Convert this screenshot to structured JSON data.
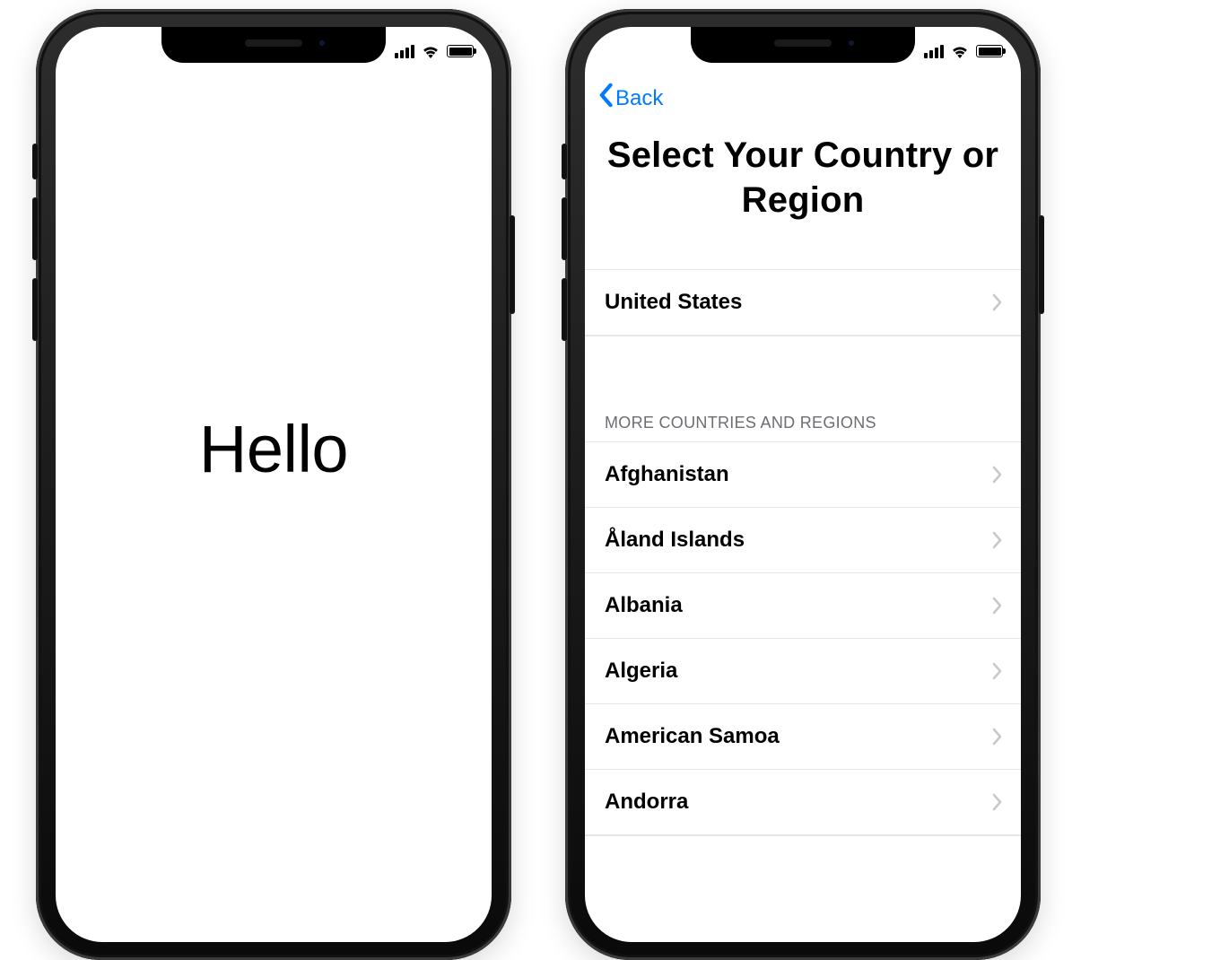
{
  "left_screen": {
    "greeting": "Hello"
  },
  "right_screen": {
    "back_label": "Back",
    "title": "Select Your Country or Region",
    "primary_country": "United States",
    "more_section_header": "MORE COUNTRIES AND REGIONS",
    "countries": [
      "Afghanistan",
      "Åland Islands",
      "Albania",
      "Algeria",
      "American Samoa",
      "Andorra"
    ]
  },
  "status": {
    "cellular_bars": 4,
    "wifi": true,
    "battery_full": true
  },
  "colors": {
    "ios_blue": "#007aff",
    "separator": "#e5e5ea",
    "chevron": "#c7c7cc",
    "section_header": "#6d6d72"
  },
  "icons": {
    "back": "chevron-left-icon",
    "disclosure": "chevron-right-icon",
    "cellular": "cellular-icon",
    "wifi": "wifi-icon",
    "battery": "battery-icon"
  }
}
